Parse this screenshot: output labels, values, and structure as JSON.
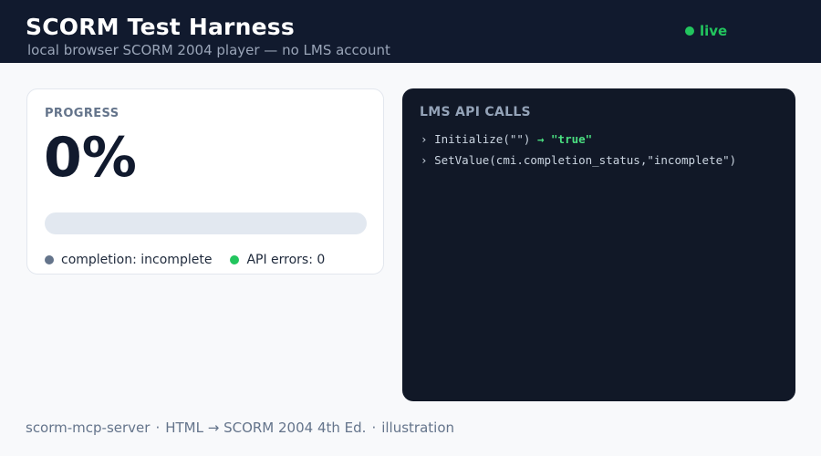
{
  "header": {
    "title": "SCORM Test Harness",
    "subtitle": "local browser SCORM 2004 player — no LMS account",
    "status_label": "live",
    "status_color": "#22c55e"
  },
  "progress_card": {
    "title": "PROGRESS",
    "percent_label": "0%",
    "progress_value": 0,
    "completion_label": "completion: incomplete",
    "errors_label": "API errors: 0"
  },
  "console": {
    "title": "LMS API CALLS",
    "lines": [
      {
        "prompt": "›",
        "call": "Initialize(\"\")",
        "arrow": "→",
        "result": "\"true\""
      },
      {
        "prompt": "›",
        "call": "SetValue(cmi.completion_status,\"incomplete\")",
        "arrow": "",
        "result": ""
      }
    ]
  },
  "footer": {
    "item1": "scorm-mcp-server",
    "item2": "HTML → SCORM 2004 4th Ed.",
    "item3": "illustration",
    "separator": "·"
  },
  "colors": {
    "header_bg": "#111a2e",
    "accent_green": "#22c55e",
    "console_bg": "#111827"
  }
}
